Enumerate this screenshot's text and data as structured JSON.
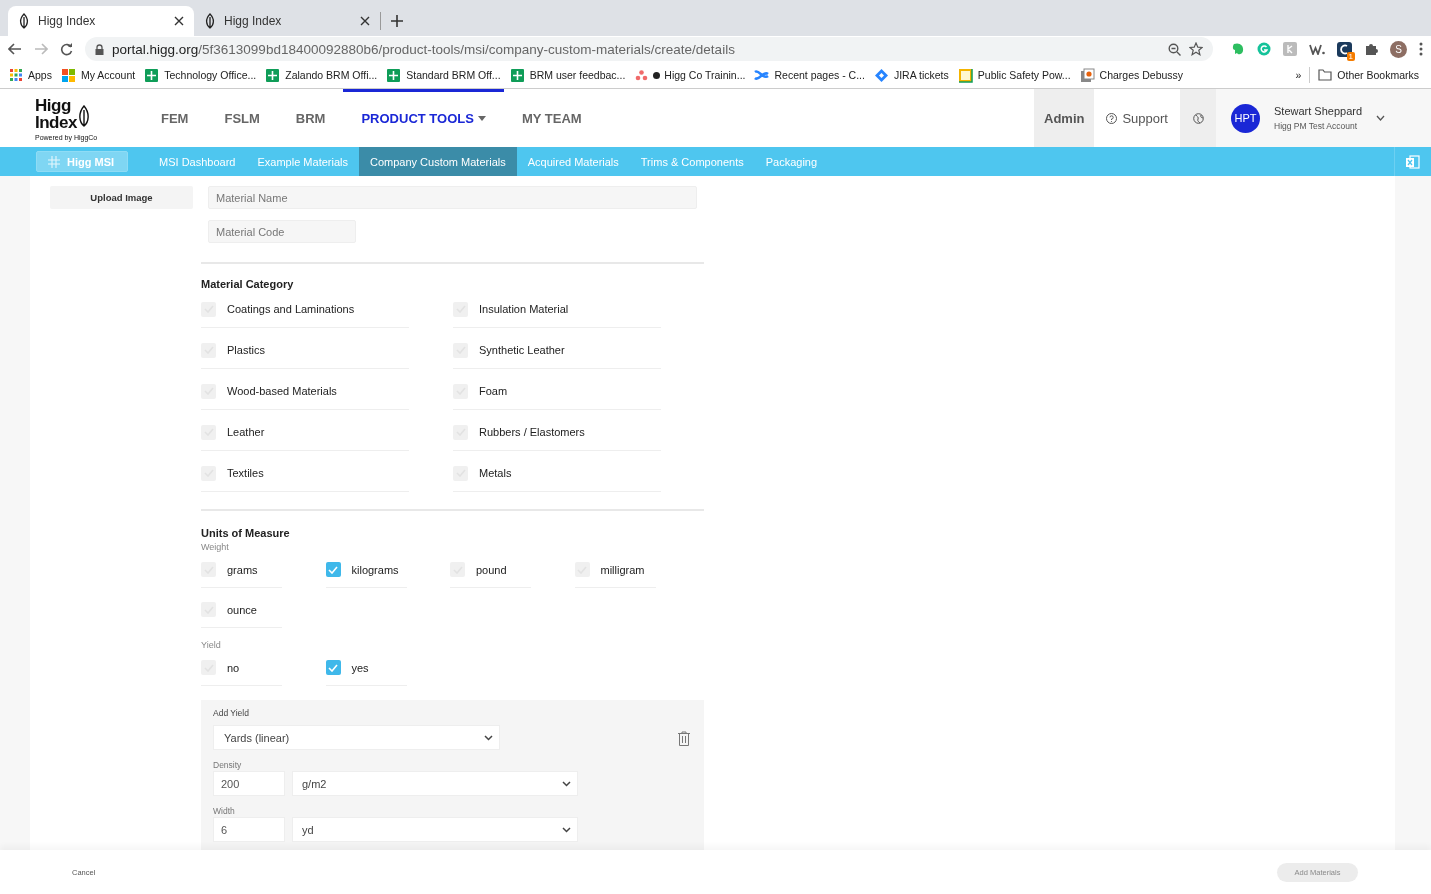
{
  "browser": {
    "tabs": [
      {
        "title": "Higg Index",
        "selected": true
      },
      {
        "title": "Higg Index",
        "selected": false
      }
    ],
    "url": {
      "host": "portal.higg.org",
      "path": "/5f3613099bd18400092880b6/product-tools/msi/company-custom-materials/create/details"
    },
    "extension_badge": "1",
    "profile_initial": "S",
    "apps_label": "Apps",
    "bookmarks": [
      {
        "label": "My Account",
        "kind": "windows"
      },
      {
        "label": "Technology Office...",
        "kind": "sheet"
      },
      {
        "label": "Zalando BRM Offi...",
        "kind": "sheet"
      },
      {
        "label": "Standard BRM Off...",
        "kind": "sheet"
      },
      {
        "label": "BRM user feedbac...",
        "kind": "sheet"
      },
      {
        "label": "Higg Co Trainin...",
        "kind": "dots"
      },
      {
        "label": "Recent pages - C...",
        "kind": "cross"
      },
      {
        "label": "JIRA tickets",
        "kind": "diamond"
      },
      {
        "label": "Public Safety Pow...",
        "kind": "slides"
      },
      {
        "label": "Charges Debussy",
        "kind": "office"
      }
    ],
    "overflow": "»",
    "other_bookmarks": "Other Bookmarks"
  },
  "header": {
    "logo": {
      "line1": "Higg",
      "line2": "Index",
      "tagline": "Powered by HiggCo"
    },
    "nav": [
      {
        "label": "FEM",
        "selected": false,
        "dropdown": false
      },
      {
        "label": "FSLM",
        "selected": false,
        "dropdown": false
      },
      {
        "label": "BRM",
        "selected": false,
        "dropdown": false
      },
      {
        "label": "PRODUCT TOOLS",
        "selected": true,
        "dropdown": true
      },
      {
        "label": "MY TEAM",
        "selected": false,
        "dropdown": false
      }
    ],
    "admin": "Admin",
    "support": "Support",
    "avatar": "HPT",
    "user_name": "Stewart Sheppard",
    "user_account": "Higg PM Test Account"
  },
  "subnav": {
    "app": "Higg MSI",
    "tabs": [
      {
        "label": "MSI Dashboard",
        "selected": false
      },
      {
        "label": "Example Materials",
        "selected": false
      },
      {
        "label": "Company Custom Materials",
        "selected": true
      },
      {
        "label": "Acquired Materials",
        "selected": false
      },
      {
        "label": "Trims & Components",
        "selected": false
      },
      {
        "label": "Packaging",
        "selected": false
      }
    ]
  },
  "form": {
    "upload": "Upload Image",
    "name_placeholder": "Material Name",
    "code_placeholder": "Material Code",
    "category": {
      "title": "Material Category",
      "options": [
        {
          "label": "Coatings and Laminations",
          "checked": false
        },
        {
          "label": "Insulation Material",
          "checked": false
        },
        {
          "label": "Plastics",
          "checked": false
        },
        {
          "label": "Synthetic Leather",
          "checked": false
        },
        {
          "label": "Wood-based Materials",
          "checked": false
        },
        {
          "label": "Foam",
          "checked": false
        },
        {
          "label": "Leather",
          "checked": false
        },
        {
          "label": "Rubbers / Elastomers",
          "checked": false
        },
        {
          "label": "Textiles",
          "checked": false
        },
        {
          "label": "Metals",
          "checked": false
        }
      ]
    },
    "units": {
      "title": "Units of Measure",
      "weight": {
        "label": "Weight",
        "options": [
          {
            "label": "grams",
            "checked": false
          },
          {
            "label": "kilograms",
            "checked": true
          },
          {
            "label": "pound",
            "checked": false
          },
          {
            "label": "milligram",
            "checked": false
          },
          {
            "label": "ounce",
            "checked": false
          }
        ]
      },
      "yield": {
        "label": "Yield",
        "options": [
          {
            "label": "no",
            "checked": false
          },
          {
            "label": "yes",
            "checked": true
          }
        ]
      }
    },
    "add_yield": {
      "title": "Add Yield",
      "unit": "Yards (linear)",
      "density": {
        "label": "Density",
        "value": "200",
        "unit": "g/m2"
      },
      "width": {
        "label": "Width",
        "value": "6",
        "unit": "yd"
      }
    }
  },
  "footer": {
    "cancel": "Cancel",
    "submit": {
      "label": "Add Materials",
      "disabled": true
    }
  }
}
